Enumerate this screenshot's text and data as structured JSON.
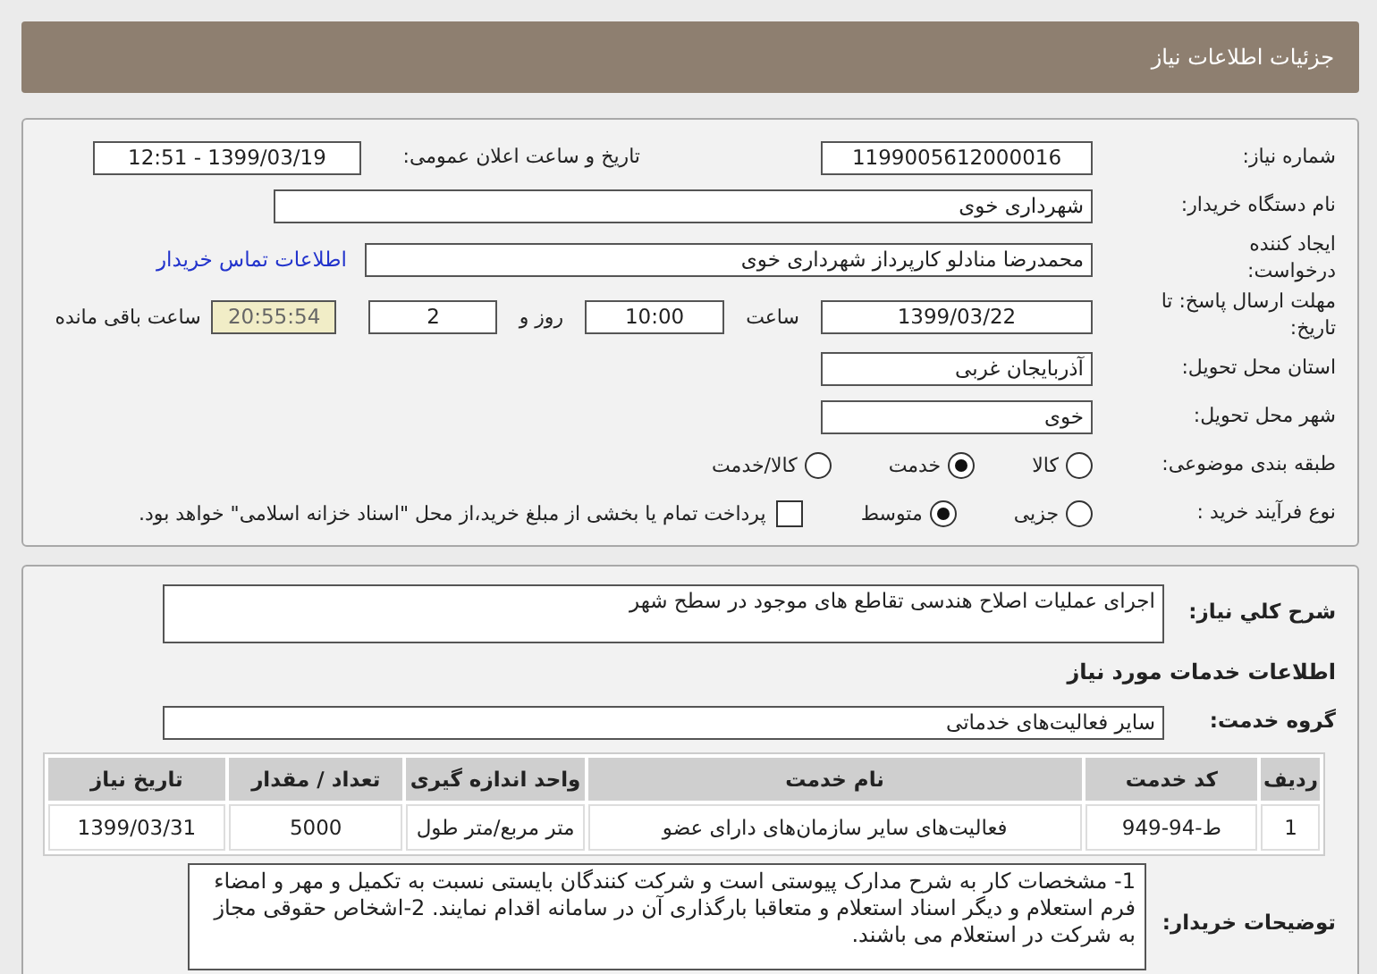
{
  "header": {
    "title": "جزئیات اطلاعات نیاز"
  },
  "general": {
    "need_number": {
      "label": "شماره نیاز:",
      "value": "1199005612000016"
    },
    "announce": {
      "label": "تاریخ و ساعت اعلان عمومی:",
      "value": "1399/03/19 - 12:51"
    },
    "buyer": {
      "label": "نام دستگاه خریدار:",
      "value": "شهرداری خوی"
    },
    "creator": {
      "label": "ایجاد کننده درخواست:",
      "value": "محمدرضا منادلو کارپرداز شهرداری خوی",
      "link": "اطلاعات تماس خریدار"
    },
    "deadline": {
      "label": "مهلت ارسال پاسخ: تا تاریخ:",
      "date": "1399/03/22",
      "time_label": "ساعت",
      "time": "10:00",
      "days": "2",
      "days_label": "روز و",
      "remaining": "20:55:54",
      "remaining_label": "ساعت باقی مانده"
    },
    "province": {
      "label": "استان محل تحویل:",
      "value": "آذربایجان غربی"
    },
    "city": {
      "label": "شهر محل تحویل:",
      "value": "خوی"
    },
    "category": {
      "label": "طبقه بندی موضوعی:",
      "options": [
        {
          "label": "کالا",
          "selected": false
        },
        {
          "label": "خدمت",
          "selected": true
        },
        {
          "label": "کالا/خدمت",
          "selected": false
        }
      ]
    },
    "process": {
      "label": "نوع فرآیند خرید :",
      "options": [
        {
          "label": "جزیی",
          "selected": false
        },
        {
          "label": "متوسط",
          "selected": true
        }
      ],
      "treasury": {
        "label": "پرداخت تمام یا بخشی از مبلغ خرید،از محل \"اسناد خزانه اسلامی\" خواهد بود.",
        "checked": false
      }
    }
  },
  "details": {
    "description": {
      "label": "شرح کلي نياز:",
      "value": "اجرای عملیات اصلاح هندسی تقاطع های موجود در سطح شهر"
    },
    "services_heading": "اطلاعات خدمات مورد نیاز",
    "service_group": {
      "label": "گروه خدمت:",
      "value": "سایر فعالیت‌های خدماتی"
    },
    "table": {
      "columns": [
        "ردیف",
        "کد خدمت",
        "نام خدمت",
        "واحد اندازه گیری",
        "تعداد / مقدار",
        "تاریخ نیاز"
      ],
      "rows": [
        [
          "1",
          "ط-94-949",
          "فعالیت‌های سایر سازمان‌های دارای عضو",
          "متر مربع/متر طول",
          "5000",
          "1399/03/31"
        ]
      ]
    },
    "buyer_notes": {
      "label": "توضیحات خریدار:",
      "value": "1- مشخصات کار به شرح مدارک پیوستی است و  شرکت کنندگان بایستی نسبت به تکمیل و مهر و امضاء فرم استعلام و دیگر اسناد استعلام  و متعاقبا بارگذاری آن در سامانه اقدام نمایند. 2-اشخاص حقوقی مجاز به شرکت در استعلام می باشند."
    }
  }
}
